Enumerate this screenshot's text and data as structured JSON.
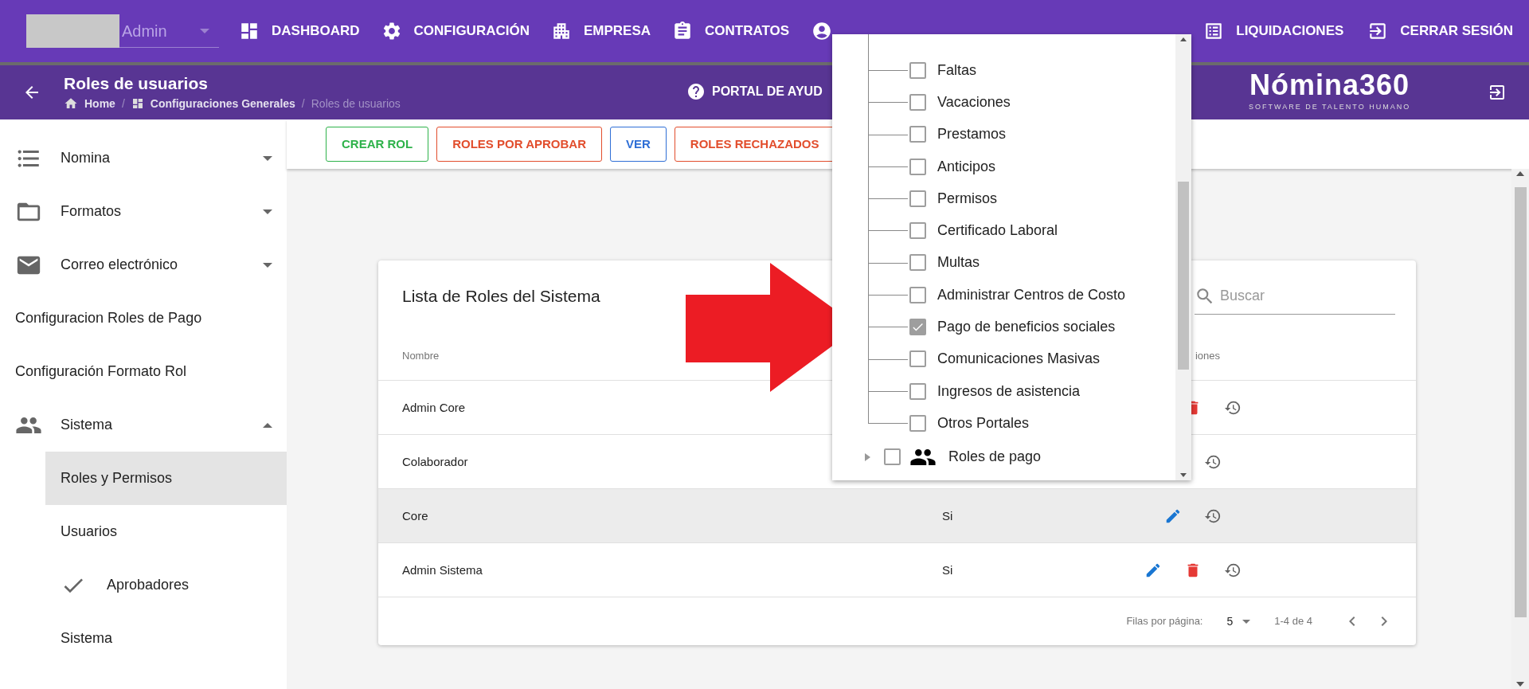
{
  "top_nav": {
    "user": "Admin",
    "items_left": [
      "DASHBOARD",
      "CONFIGURACIÓN",
      "EMPRESA",
      "CONTRATOS"
    ],
    "items_right": [
      "LIQUIDACIONES",
      "CERRAR SESIÓN"
    ]
  },
  "page_header": {
    "title": "Roles de usuarios",
    "breadcrumb": [
      "Home",
      "Configuraciones Generales",
      "Roles de usuarios"
    ],
    "breadcrumb_separators": [
      "/",
      "/"
    ],
    "help_link": "PORTAL DE AYUD",
    "logo": "Nómina360",
    "logo_tagline": "SOFTWARE DE TALENTO HUMANO"
  },
  "sidebar": [
    {
      "label": "Nomina",
      "kind": "group",
      "expanded": false
    },
    {
      "label": "Formatos",
      "kind": "group",
      "expanded": false
    },
    {
      "label": "Correo electrónico",
      "kind": "group",
      "expanded": false
    },
    {
      "label": "Configuracion Roles de Pago",
      "kind": "link"
    },
    {
      "label": "Configuración Formato Rol",
      "kind": "link"
    },
    {
      "label": "Sistema",
      "kind": "group",
      "expanded": true,
      "children": [
        {
          "label": "Roles y Permisos",
          "kind": "item",
          "selected": true
        },
        {
          "label": "Usuarios",
          "kind": "item",
          "selected": false
        },
        {
          "label": "Aprobadores",
          "kind": "check_item",
          "selected": false
        },
        {
          "label": "Sistema",
          "kind": "item",
          "selected": false
        }
      ]
    }
  ],
  "toolbar": [
    {
      "label": "CREAR ROL",
      "color": "#2eb24a"
    },
    {
      "label": "ROLES POR APROBAR",
      "color": "#e24d2c"
    },
    {
      "label": "VER",
      "color": "#2f6fd6"
    },
    {
      "label": "ROLES RECHAZADOS",
      "color": "#e24d2c"
    }
  ],
  "card": {
    "title": "Lista de Roles del Sistema",
    "search": {
      "placeholder": "Buscar"
    },
    "columns": [
      "Nombre",
      "iones"
    ],
    "rows": [
      {
        "name": "Admin Core",
        "selected": false,
        "actions": [
          {
            "kind": "covered"
          },
          {
            "kind": "delete"
          },
          {
            "kind": "history"
          }
        ]
      },
      {
        "name": "Colaborador",
        "selected": false,
        "actions": [
          {
            "kind": "covered"
          },
          {
            "kind": "history"
          }
        ]
      },
      {
        "name": "Core",
        "value": "Si",
        "selected": true,
        "actions": [
          {
            "kind": "edit"
          },
          {
            "kind": "history"
          }
        ]
      },
      {
        "name": "Admin Sistema",
        "value": "Si",
        "selected": false,
        "actions": [
          {
            "kind": "edit"
          },
          {
            "kind": "delete"
          },
          {
            "kind": "history"
          }
        ]
      }
    ],
    "pagination": {
      "label": "Filas por página:",
      "rows_per_page": "5",
      "range": "1-4 de 4"
    }
  },
  "permissions_dropdown": {
    "children": [
      {
        "label": "Faltas",
        "checked": false
      },
      {
        "label": "Vacaciones",
        "checked": false
      },
      {
        "label": "Prestamos",
        "checked": false
      },
      {
        "label": "Anticipos",
        "checked": false
      },
      {
        "label": "Permisos",
        "checked": false
      },
      {
        "label": "Certificado Laboral",
        "checked": false
      },
      {
        "label": "Multas",
        "checked": false
      },
      {
        "label": "Administrar Centros de Costo",
        "checked": false
      },
      {
        "label": "Pago de beneficios sociales",
        "checked": true
      },
      {
        "label": "Comunicaciones Masivas",
        "checked": false
      },
      {
        "label": "Ingresos de asistencia",
        "checked": false
      },
      {
        "label": "Otros Portales",
        "checked": false
      }
    ],
    "next_nodes": [
      {
        "label": "Roles de pago",
        "checked": false,
        "expanded": false
      }
    ]
  }
}
